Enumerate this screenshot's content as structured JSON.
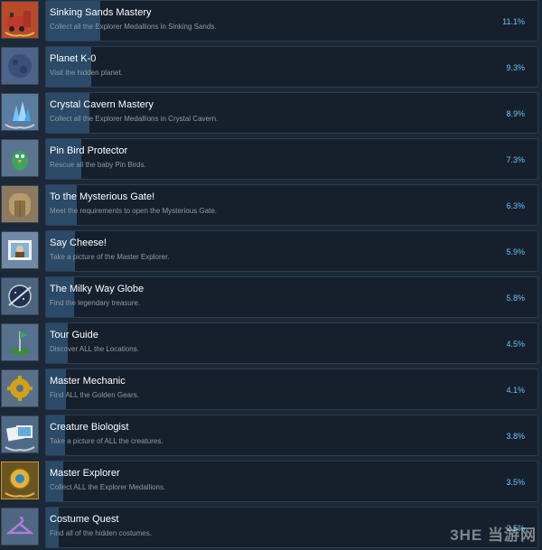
{
  "achievements": [
    {
      "title": "Sinking Sands Mastery",
      "description": "Collect all the Explorer Medallions in Sinking Sands.",
      "percent": "11.1%",
      "fraction": 0.111,
      "icon": "train-icon",
      "icon_bg": "#b84a2a"
    },
    {
      "title": "Planet K-0",
      "description": "Visit the hidden planet.",
      "percent": "9.3%",
      "fraction": 0.093,
      "icon": "planet-icon",
      "icon_bg": "#4d6488"
    },
    {
      "title": "Crystal Cavern Mastery",
      "description": "Collect all the Explorer Medallions in Crystal Cavern.",
      "percent": "8.9%",
      "fraction": 0.089,
      "icon": "crystal-icon",
      "icon_bg": "#5a7c9e"
    },
    {
      "title": "Pin Bird Protector",
      "description": "Rescue all the baby Pin Birds.",
      "percent": "7.3%",
      "fraction": 0.073,
      "icon": "bird-icon",
      "icon_bg": "#5b7590"
    },
    {
      "title": "To the Mysterious Gate!",
      "description": "Meet the requirements to open the Mysterious Gate.",
      "percent": "6.3%",
      "fraction": 0.063,
      "icon": "gate-icon",
      "icon_bg": "#8c7a60"
    },
    {
      "title": "Say Cheese!",
      "description": "Take a picture of the Master Explorer.",
      "percent": "5.9%",
      "fraction": 0.059,
      "icon": "camera-photo-icon",
      "icon_bg": "#6e8aa6"
    },
    {
      "title": "The Milky Way Globe",
      "description": "Find the legendary treasure.",
      "percent": "5.8%",
      "fraction": 0.058,
      "icon": "globe-icon",
      "icon_bg": "#4c6480"
    },
    {
      "title": "Tour Guide",
      "description": "Discover ALL the Locations.",
      "percent": "4.5%",
      "fraction": 0.045,
      "icon": "flag-icon",
      "icon_bg": "#55718e"
    },
    {
      "title": "Master Mechanic",
      "description": "Find ALL the Golden Gears.",
      "percent": "4.1%",
      "fraction": 0.041,
      "icon": "gear-icon",
      "icon_bg": "#5a7088"
    },
    {
      "title": "Creature Biologist",
      "description": "Take a picture of ALL the creatures.",
      "percent": "3.8%",
      "fraction": 0.038,
      "icon": "photos-icon",
      "icon_bg": "#4f6a86"
    },
    {
      "title": "Master Explorer",
      "description": "Collect ALL the Explorer Medallions.",
      "percent": "3.5%",
      "fraction": 0.035,
      "icon": "medallion-icon",
      "icon_bg": "#6a5420",
      "gold": true
    },
    {
      "title": "Costume Quest",
      "description": "Find all of the hidden costumes.",
      "percent": "2.5%",
      "fraction": 0.025,
      "icon": "hanger-icon",
      "icon_bg": "#4e6783"
    }
  ],
  "watermark": "3HE 当游网"
}
